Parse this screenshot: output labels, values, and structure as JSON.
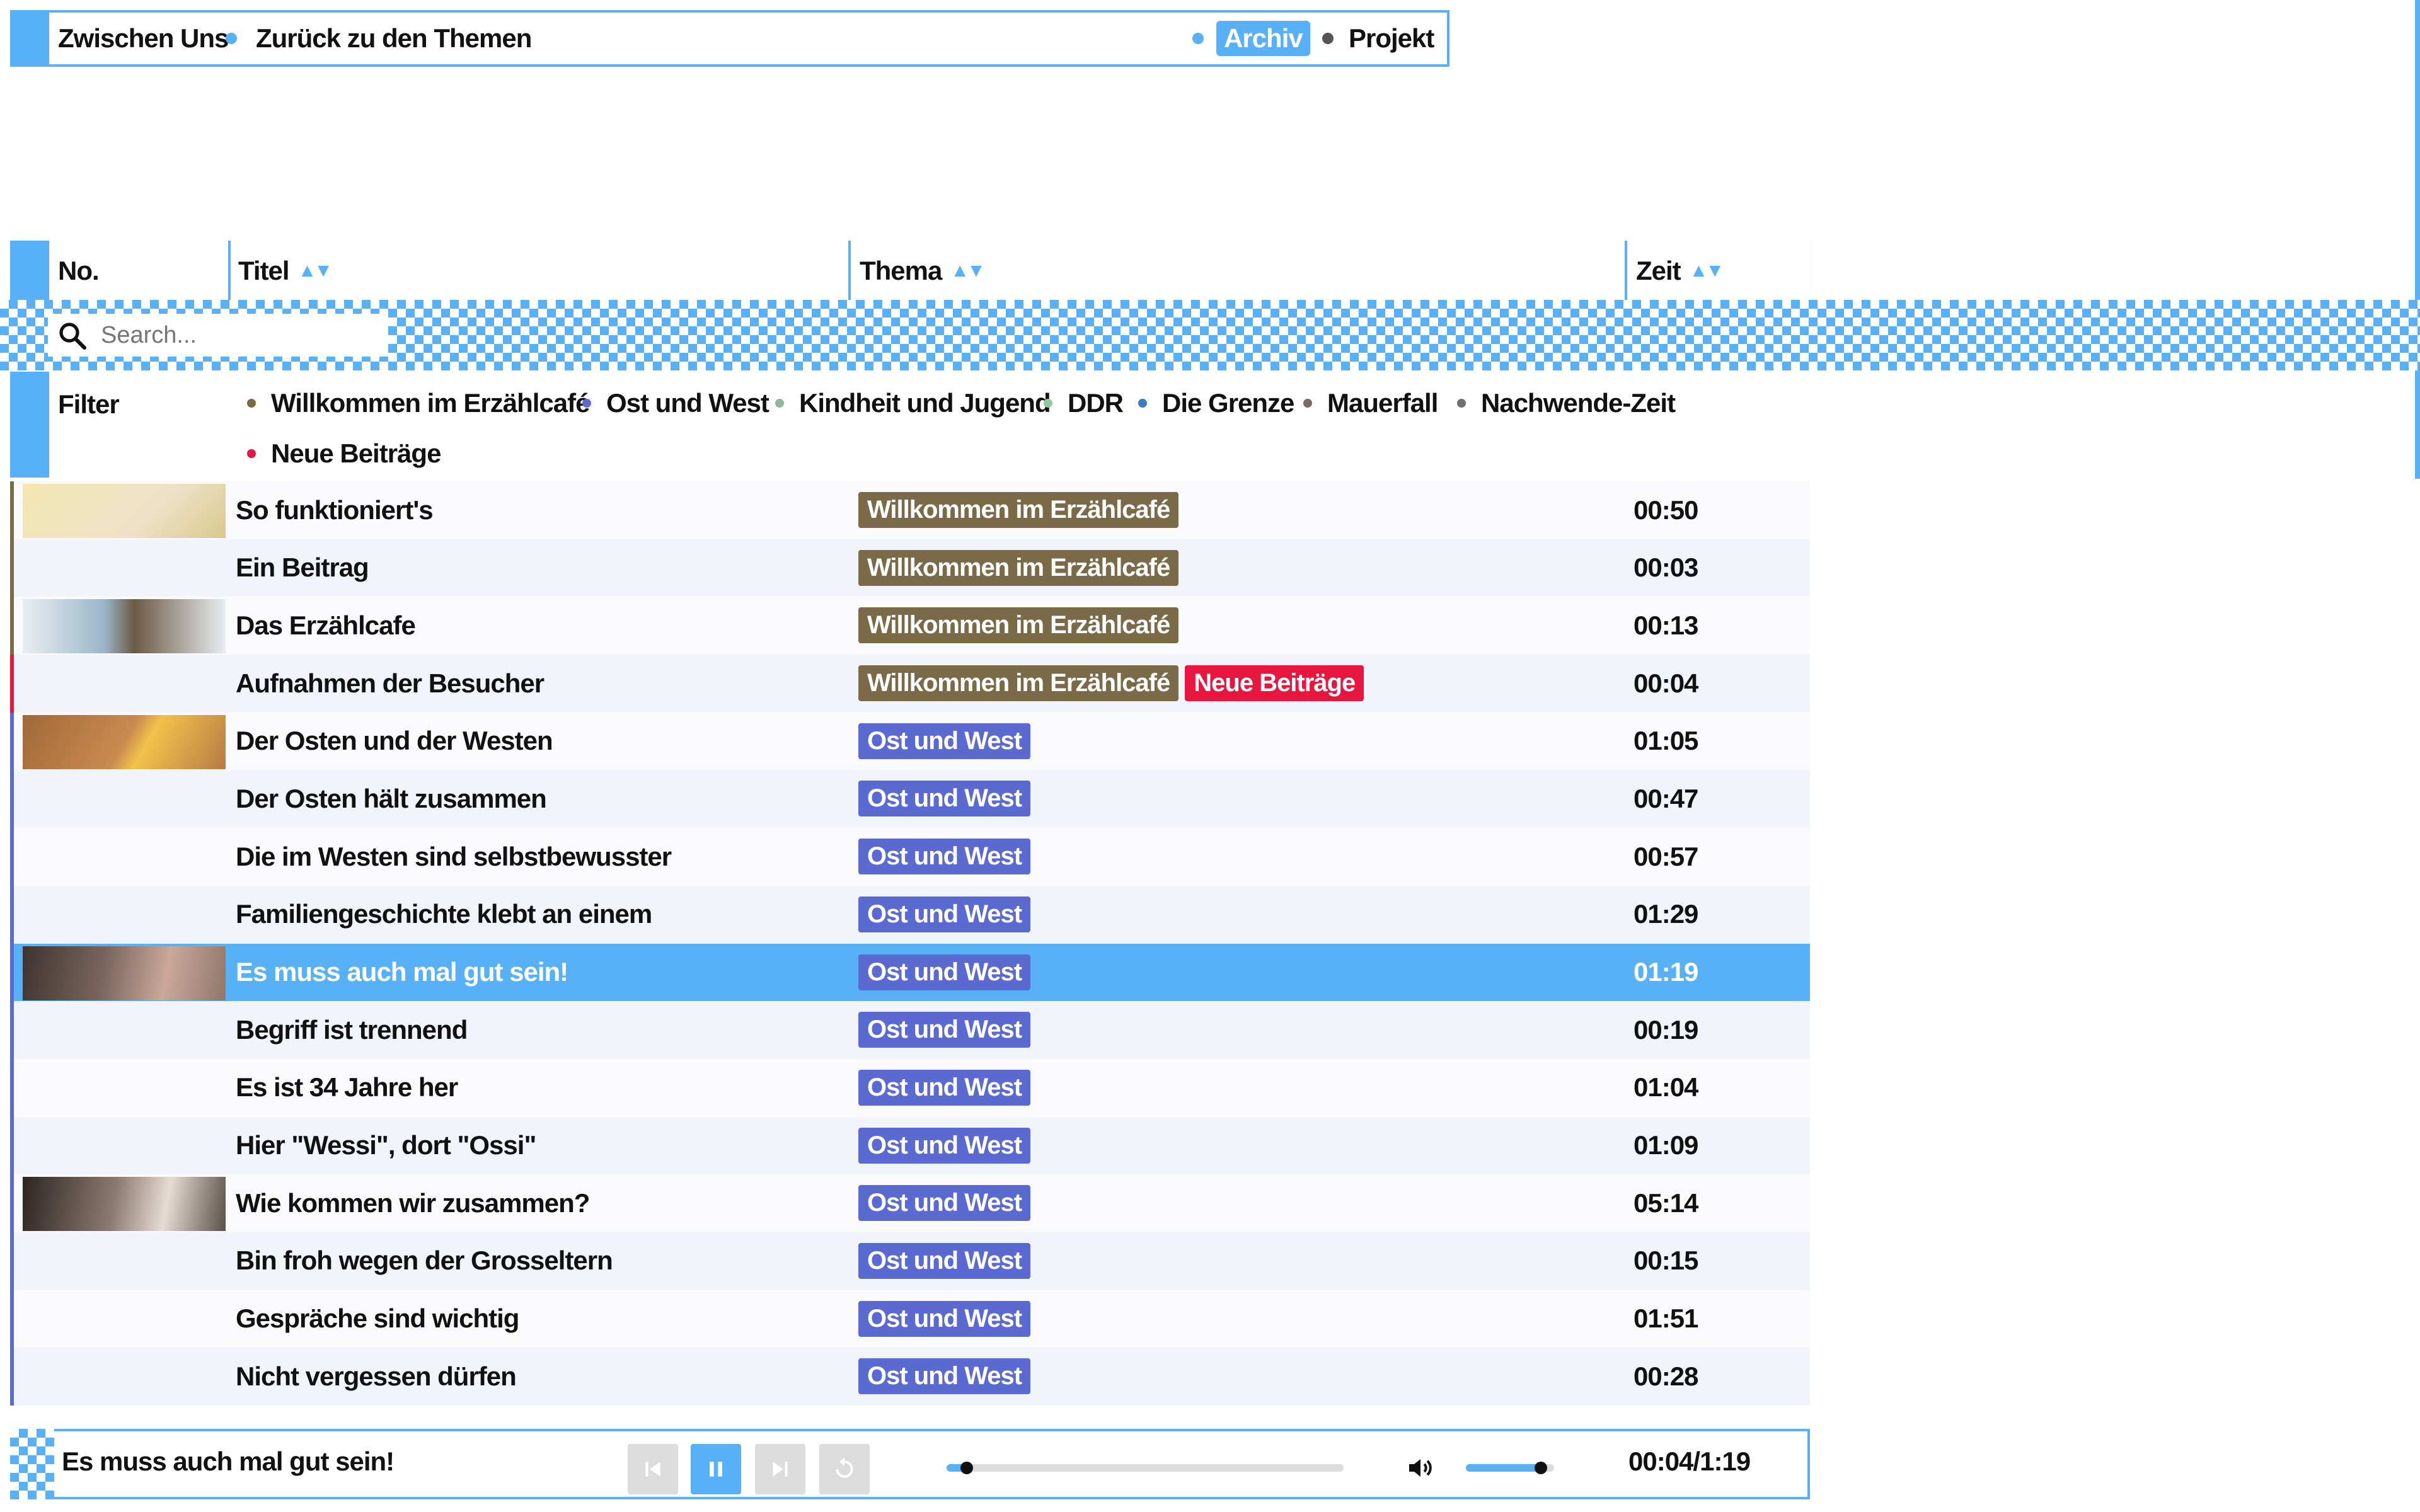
{
  "colors": {
    "accent": "#58b0f7",
    "willkommen": "#7a6a48",
    "ostwest": "#5b6ad0",
    "kindheit": "#8eb89a",
    "ddr": "#93c99a",
    "grenze": "#3f7bc5",
    "mauerfall": "#7d6a5e",
    "nachwende": "#707070",
    "neu": "#e8153f"
  },
  "nav": {
    "brand": "Zwischen Uns",
    "back": "Zurück zu den Themen",
    "archiv": "Archiv",
    "projekt": "Projekt"
  },
  "table": {
    "headers": {
      "no": "No.",
      "titel": "Titel",
      "thema": "Thema",
      "zeit": "Zeit"
    },
    "sort_glyph": "▲▼"
  },
  "search": {
    "placeholder": "Search...",
    "icon": "search-icon"
  },
  "filter": {
    "label": "Filter",
    "chips": [
      "Willkommen im Erzählcafé",
      "Ost und West",
      "Kindheit und Jugend",
      "DDR",
      "Die Grenze",
      "Mauerfall",
      "Nachwende-Zeit",
      "Neue Beiträge"
    ]
  },
  "rows": [
    {
      "title": "So funktioniert's",
      "tags": [
        "Willkommen im Erzählcafé"
      ],
      "time": "00:50"
    },
    {
      "title": "Ein Beitrag",
      "tags": [
        "Willkommen im Erzählcafé"
      ],
      "time": "00:03"
    },
    {
      "title": "Das Erzählcafe",
      "tags": [
        "Willkommen im Erzählcafé"
      ],
      "time": "00:13"
    },
    {
      "title": "Aufnahmen der Besucher",
      "tags": [
        "Willkommen im Erzählcafé",
        "Neue Beiträge"
      ],
      "time": "00:04"
    },
    {
      "title": "Der Osten und der Westen",
      "tags": [
        "Ost und West"
      ],
      "time": "01:05"
    },
    {
      "title": "Der Osten hält zusammen",
      "tags": [
        "Ost und West"
      ],
      "time": "00:47"
    },
    {
      "title": "Die im Westen sind selbstbewusster",
      "tags": [
        "Ost und West"
      ],
      "time": "00:57"
    },
    {
      "title": "Familiengeschichte klebt an einem",
      "tags": [
        "Ost und West"
      ],
      "time": "01:29"
    },
    {
      "title": "Es muss auch mal gut sein!",
      "tags": [
        "Ost und West"
      ],
      "time": "01:19"
    },
    {
      "title": "Begriff ist trennend",
      "tags": [
        "Ost und West"
      ],
      "time": "00:19"
    },
    {
      "title": "Es ist 34 Jahre her",
      "tags": [
        "Ost und West"
      ],
      "time": "01:04"
    },
    {
      "title": "Hier \"Wessi\", dort \"Ossi\"",
      "tags": [
        "Ost und West"
      ],
      "time": "01:09"
    },
    {
      "title": "Wie kommen wir zusammen?",
      "tags": [
        "Ost und West"
      ],
      "time": "05:14"
    },
    {
      "title": "Bin froh wegen der Grosseltern",
      "tags": [
        "Ost und West"
      ],
      "time": "00:15"
    },
    {
      "title": "Gespräche sind wichtig",
      "tags": [
        "Ost und West"
      ],
      "time": "01:51"
    },
    {
      "title": "Nicht vergessen dürfen",
      "tags": [
        "Ost und West"
      ],
      "time": "00:28"
    }
  ],
  "selected_row": 8,
  "player": {
    "title": "Es muss auch mal gut sein!",
    "time": "00:04/1:19",
    "progress": 0.05,
    "volume": 0.85,
    "state": "playing"
  }
}
